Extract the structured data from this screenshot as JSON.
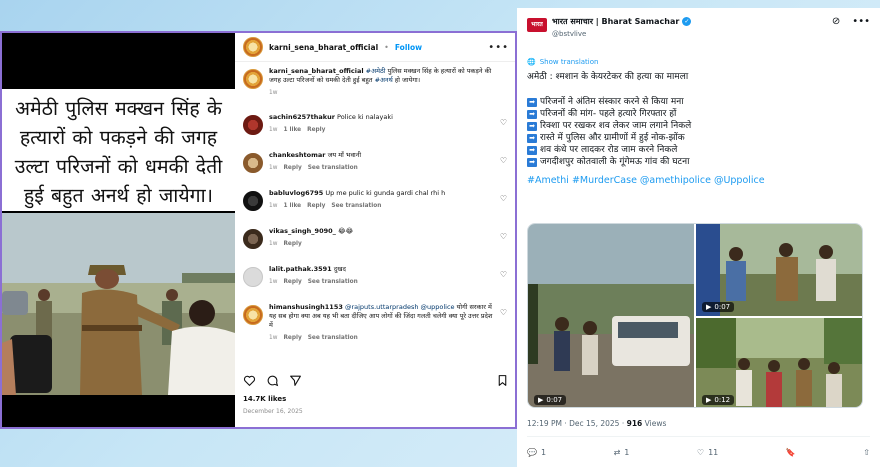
{
  "instagram": {
    "username": "karni_sena_bharat_official",
    "follow_label": "Follow",
    "more_label": "•••",
    "caption_overlay": "अमेठी पुलिस मक्खन सिंह के हत्यारों को पकड़ने की जगह उल्टा परिजनों को धमकी देती हुई बहुत अनर्थ हो जायेगा।",
    "post_caption": {
      "username": "karni_sena_bharat_official",
      "hashtag": "#अमेठी",
      "text": "पुलिस मक्खन सिंह के हत्यारों को पकड़ने की जगह उल्टा परिजनों को धमकी देती हुई बहुत",
      "hashtag2": "#अनर्थ",
      "text2": "हो जायेगा।",
      "time": "1w"
    },
    "comments": [
      {
        "user": "sachin6257thakur",
        "text": "Police ki nalayaki",
        "time": "1w",
        "likes": "1 like",
        "reply": "Reply",
        "translation": ""
      },
      {
        "user": "chankeshtomar",
        "text": "जय माँ भवानी",
        "time": "1w",
        "likes": "",
        "reply": "Reply",
        "translation": "See translation"
      },
      {
        "user": "babluvlog6795",
        "text": "Up me pulic ki gunda gardi chal rhi h",
        "time": "1w",
        "likes": "1 like",
        "reply": "Reply",
        "translation": "See translation"
      },
      {
        "user": "vikas_singh_9090_",
        "text": "😂😂",
        "time": "1w",
        "likes": "",
        "reply": "Reply",
        "translation": ""
      },
      {
        "user": "lalit.pathak.3591",
        "text": "दुखद",
        "time": "1w",
        "likes": "",
        "reply": "Reply",
        "translation": "See translation"
      },
      {
        "user": "himanshusingh1153",
        "mentions": "@rajputs.uttarpradesh @uppolice",
        "text": "योगी सरकार में यह सब होगा क्या अब यह भी बता दीजिए आप लोगों की जिंदा गलती चलेगी क्या पूरे उत्तर प्रदेश में",
        "time": "1w",
        "likes": "",
        "reply": "Reply",
        "translation": "See translation"
      }
    ],
    "likes": "14.7K likes",
    "date": "December 16, 2025"
  },
  "twitter": {
    "logo_text": "भारत",
    "display_name": "भारत समाचार | Bharat Samachar",
    "handle": "@bstvlive",
    "show_translation": "Show translation",
    "headline": "अमेठी : श्मशान के केयरटेकर की हत्या का मामला",
    "lines": [
      "परिजनों ने अंतिम संस्कार करने से किया मना",
      "परिजनों की मांग- पहले हत्यारे गिरफ्तार हों",
      "रिक्शा पर रखकर शव लेकर जाम लगाने निकले",
      "रास्ते में पुलिस और ग्रामीणों में हुई नोक-झोंक",
      "शव कंधे पर लादकर रोड जाम करने निकले",
      "जगदीशपुर कोतवाली के गूंगेमऊ गांव की घटना"
    ],
    "hashtags": "#Amethi #MurderCase @amethipolice @Uppolice",
    "videos": [
      "0:07",
      "0:07",
      "0:12"
    ],
    "timestamp": "12:19 PM · Dec 15, 2025 ·",
    "views_count": "916",
    "views_label": "Views",
    "stats": {
      "replies": "1",
      "reposts": "1",
      "likes": "11"
    }
  }
}
